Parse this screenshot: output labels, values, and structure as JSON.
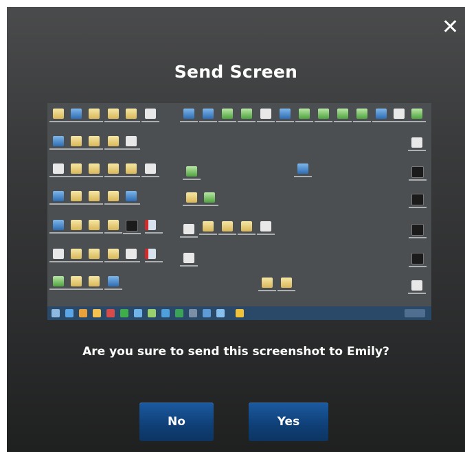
{
  "dialog": {
    "title": "Send Screen",
    "close_icon": "close-icon",
    "question": "Are you sure to send this screenshot to Emily?",
    "no_label": "No",
    "yes_label": "Yes"
  },
  "preview": {
    "description_icon": "desktop-screenshot-thumbnail"
  },
  "colors": {
    "dialog_top": "#4a4b4c",
    "dialog_bottom": "#1f2020",
    "button": "#0f3f76",
    "text": "#ffffff"
  }
}
